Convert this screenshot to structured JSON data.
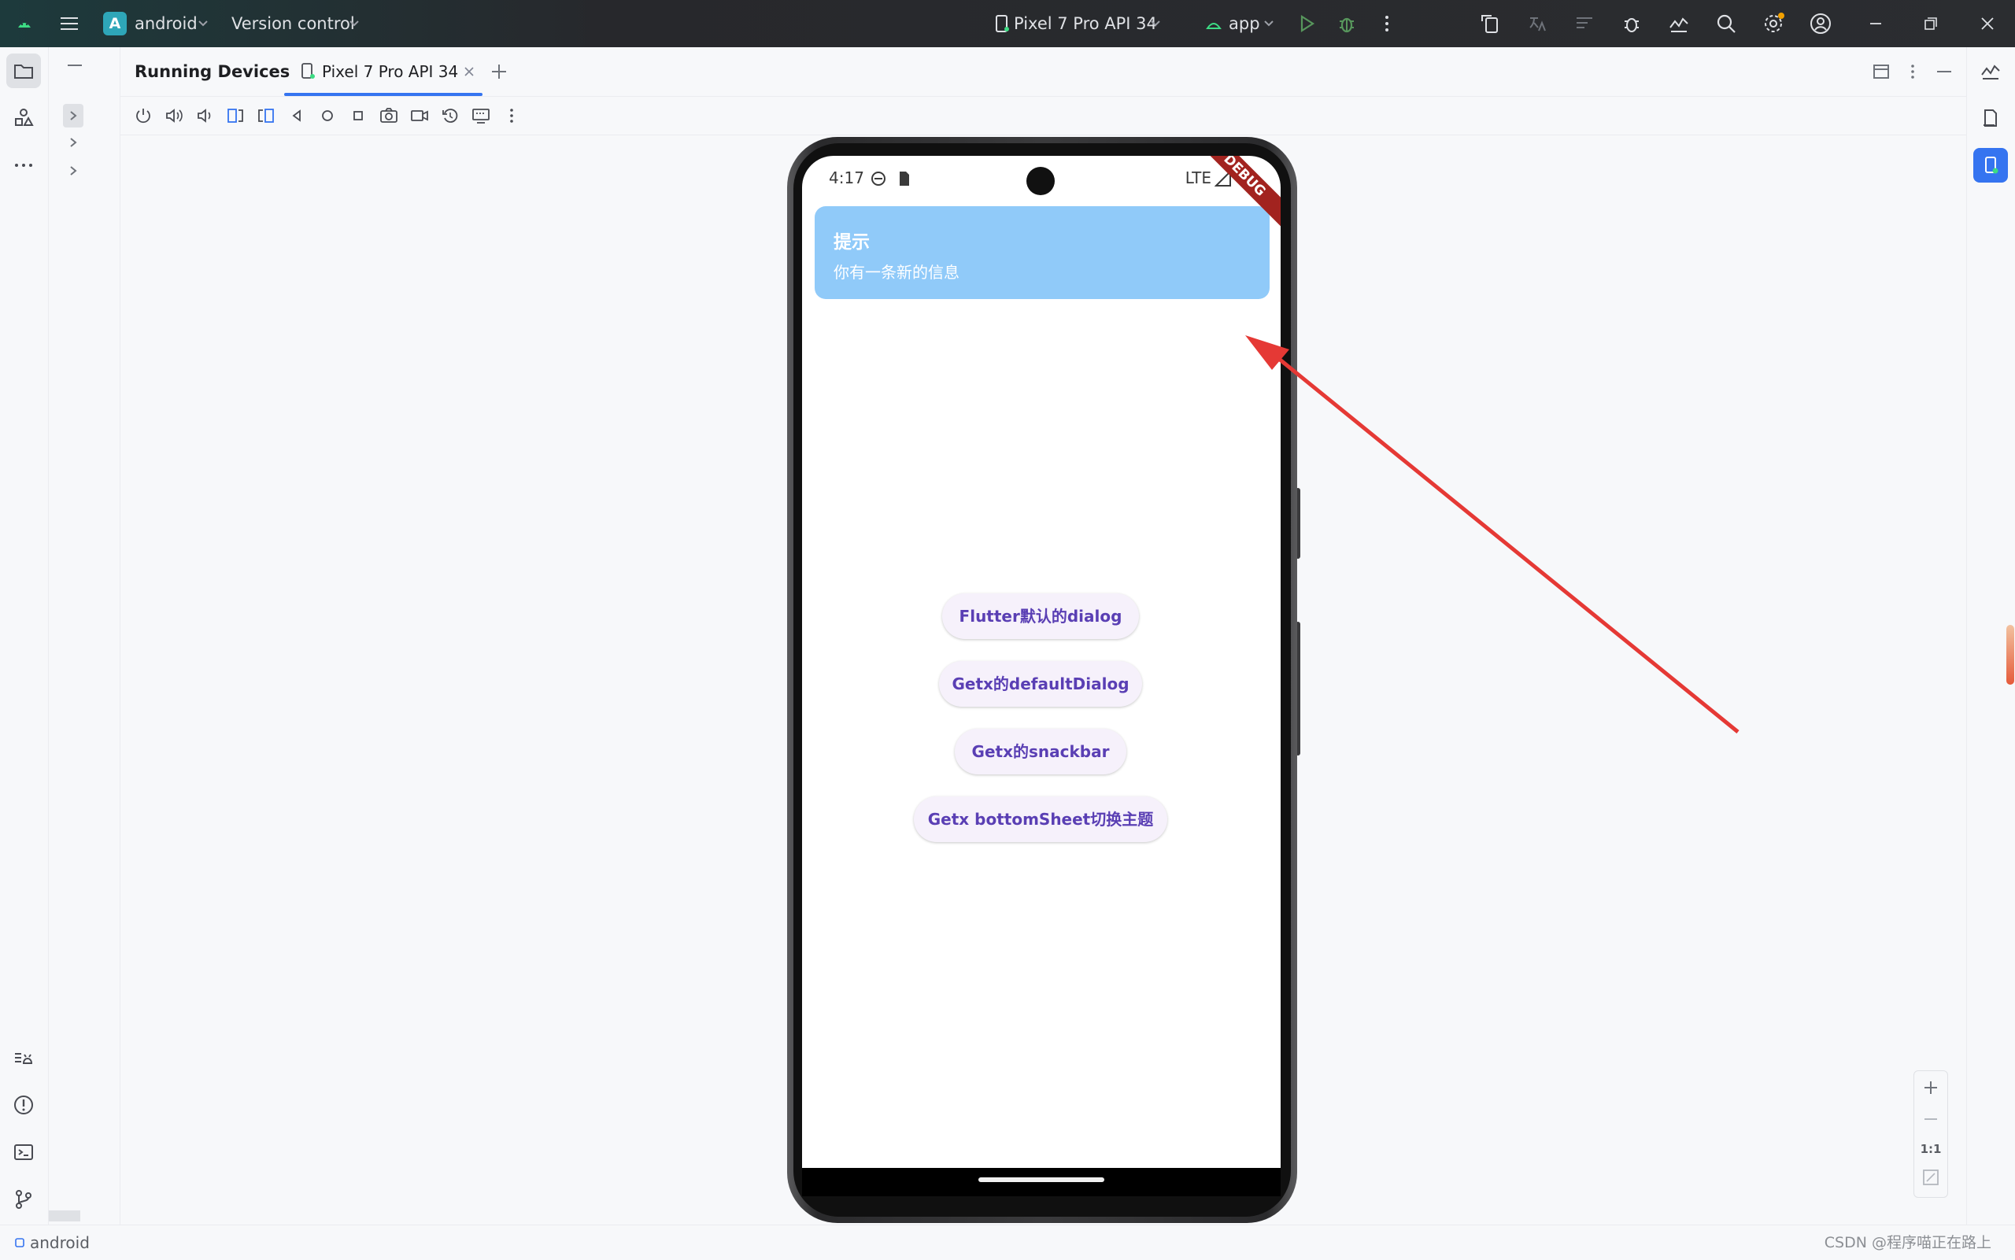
{
  "titlebar": {
    "project_badge": "A",
    "project_name": "android",
    "vcs_label": "Version control",
    "device_selector": "Pixel 7 Pro API 34",
    "run_config": "app"
  },
  "panel": {
    "title": "Running Devices",
    "tab_label": "Pixel 7 Pro API 34"
  },
  "device": {
    "status_time": "4:17",
    "status_network": "LTE",
    "debug_banner": "DEBUG",
    "snackbar": {
      "title": "提示",
      "message": "你有一条新的信息"
    },
    "buttons": [
      "Flutter默认的dialog",
      "Getx的defaultDialog",
      "Getx的snackbar",
      "Getx bottomSheet切换主题"
    ]
  },
  "zoom": {
    "ratio": "1:1"
  },
  "statusbar": {
    "project": "android",
    "watermark": "CSDN @程序喵正在路上"
  },
  "colors": {
    "accent": "#3574f0",
    "snackbar_bg": "#90caf9",
    "button_text": "#5a3fb4",
    "annotation_arrow": "#e53935"
  }
}
